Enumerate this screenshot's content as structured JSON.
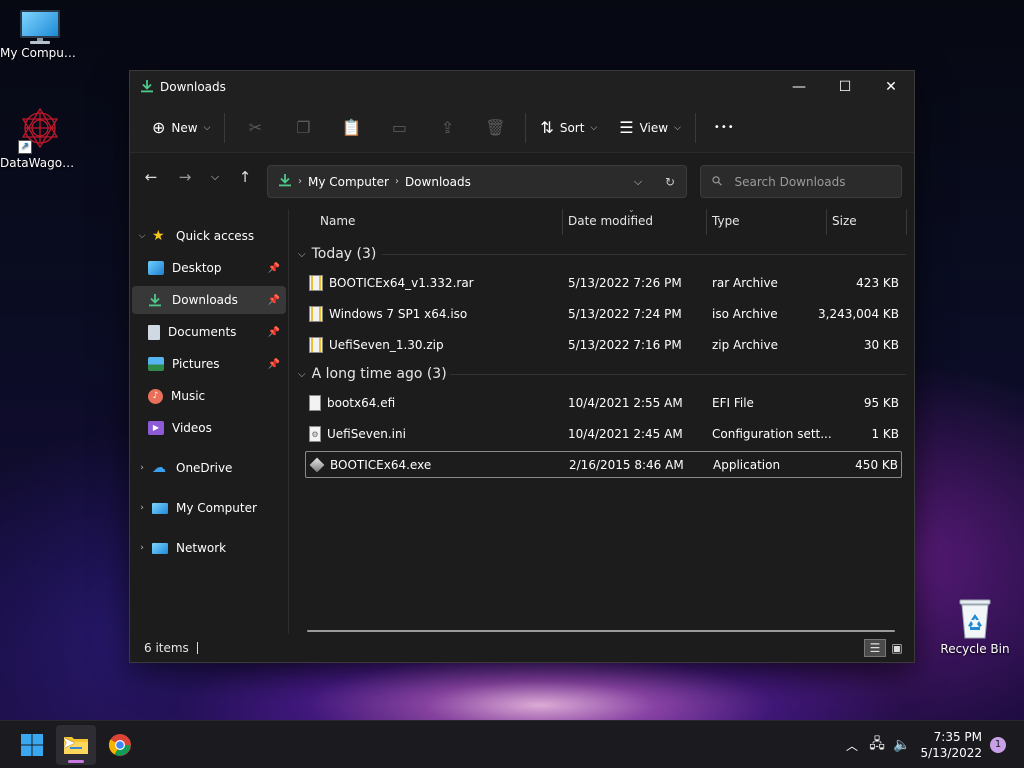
{
  "desktop": {
    "icons": [
      {
        "label": "My Computer"
      },
      {
        "label": "DataWagon..."
      },
      {
        "label": "Recycle Bin"
      }
    ]
  },
  "window": {
    "title": "Downloads",
    "controls": {
      "minimize": "—",
      "maximize": "☐",
      "close": "✕"
    }
  },
  "toolbar": {
    "new_label": "New",
    "sort_label": "Sort",
    "view_label": "View",
    "more_label": "•••"
  },
  "address": {
    "crumbs": [
      "My Computer",
      "Downloads"
    ]
  },
  "search": {
    "placeholder": "Search Downloads"
  },
  "sidebar": {
    "quick_access": "Quick access",
    "items": [
      {
        "label": "Desktop",
        "icon": "desktop-folder-icon",
        "pinned": true
      },
      {
        "label": "Downloads",
        "icon": "downloads-folder-icon",
        "pinned": true,
        "active": true
      },
      {
        "label": "Documents",
        "icon": "documents-folder-icon",
        "pinned": true
      },
      {
        "label": "Pictures",
        "icon": "pictures-folder-icon",
        "pinned": true
      },
      {
        "label": "Music",
        "icon": "music-folder-icon",
        "pinned": false
      },
      {
        "label": "Videos",
        "icon": "videos-folder-icon",
        "pinned": false
      }
    ],
    "onedrive": "OneDrive",
    "mycomputer": "My Computer",
    "network": "Network"
  },
  "columns": {
    "name": "Name",
    "date": "Date modified",
    "type": "Type",
    "size": "Size"
  },
  "groups": [
    {
      "title": "Today (3)",
      "files": [
        {
          "name": "BOOTICEx64_v1.332.rar",
          "date": "5/13/2022 7:26 PM",
          "type": "rar Archive",
          "size": "423 KB",
          "icon": "rar-archive-icon"
        },
        {
          "name": "Windows 7 SP1 x64.iso",
          "date": "5/13/2022 7:24 PM",
          "type": "iso Archive",
          "size": "3,243,004 KB",
          "icon": "iso-archive-icon"
        },
        {
          "name": "UefiSeven_1.30.zip",
          "date": "5/13/2022 7:16 PM",
          "type": "zip Archive",
          "size": "30 KB",
          "icon": "zip-archive-icon"
        }
      ]
    },
    {
      "title": "A long time ago (3)",
      "files": [
        {
          "name": "bootx64.efi",
          "date": "10/4/2021 2:55 AM",
          "type": "EFI File",
          "size": "95 KB",
          "icon": "generic-file-icon"
        },
        {
          "name": "UefiSeven.ini",
          "date": "10/4/2021 2:45 AM",
          "type": "Configuration sett...",
          "size": "1 KB",
          "icon": "settings-file-icon"
        },
        {
          "name": "BOOTICEx64.exe",
          "date": "2/16/2015 8:46 AM",
          "type": "Application",
          "size": "450 KB",
          "icon": "application-icon"
        }
      ]
    }
  ],
  "status": {
    "count": "6 items"
  },
  "taskbar": {
    "time": "7:35 PM",
    "date": "5/13/2022",
    "notifications": "1"
  }
}
